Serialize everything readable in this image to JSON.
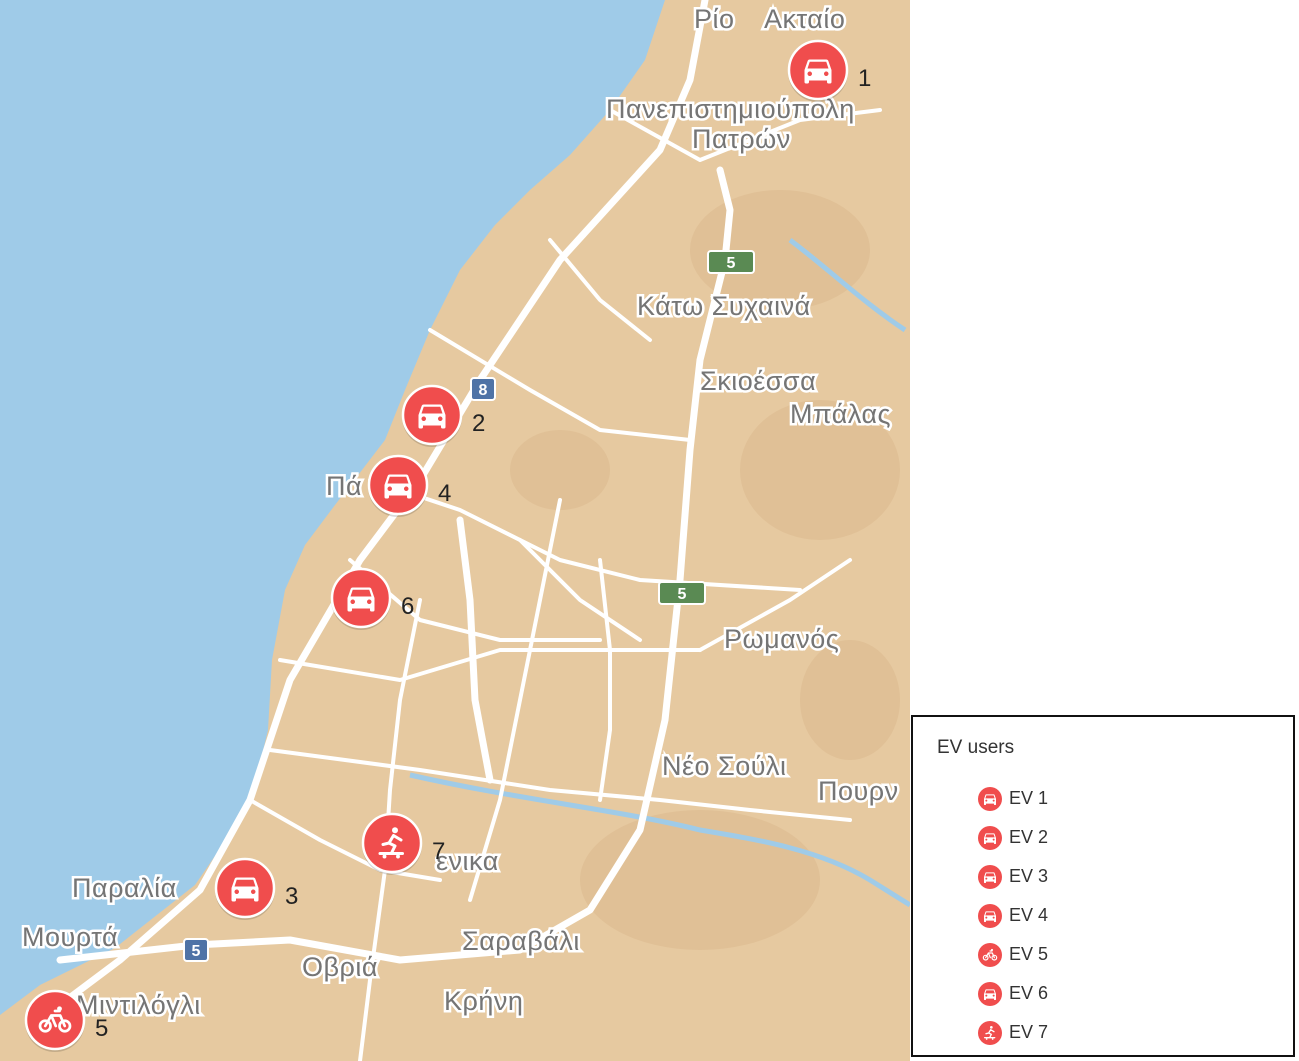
{
  "colors": {
    "water": "#9fcbe8",
    "land": "#e6c9a0",
    "road": "#ffffff",
    "marker": "#f04d4d",
    "shield_green": "#5a8a53",
    "shield_blue": "#4f73a6"
  },
  "places": [
    {
      "text": "Ρίο"
    },
    {
      "text": "Ακταίο"
    },
    {
      "text": "Πανεπιστημιούπολη"
    },
    {
      "text": "Πατρών"
    },
    {
      "text": "Κάτω Συχαινά"
    },
    {
      "text": "Σκιοέσσα"
    },
    {
      "text": "Μπάλας"
    },
    {
      "text": "Πά"
    },
    {
      "text": "Ρωμανός"
    },
    {
      "text": "Νέο Σούλι"
    },
    {
      "text": "Πουρν"
    },
    {
      "text": "ενικα"
    },
    {
      "text": "Παραλία"
    },
    {
      "text": "Μουρτά"
    },
    {
      "text": "Σαραβάλι"
    },
    {
      "text": "Οβριά"
    },
    {
      "text": "Κρήνη"
    },
    {
      "text": "Μιντιλόγλι"
    }
  ],
  "shields": [
    {
      "text": "5",
      "color": "green"
    },
    {
      "text": "8",
      "color": "blue"
    },
    {
      "text": "5",
      "color": "green"
    },
    {
      "text": "5",
      "color": "blue"
    }
  ],
  "markers": [
    {
      "number": "1",
      "icon": "car-icon"
    },
    {
      "number": "2",
      "icon": "car-icon"
    },
    {
      "number": "4",
      "icon": "car-icon"
    },
    {
      "number": "6",
      "icon": "car-icon"
    },
    {
      "number": "7",
      "icon": "skateboard-icon"
    },
    {
      "number": "3",
      "icon": "car-icon"
    },
    {
      "number": "5",
      "icon": "bicycle-icon"
    }
  ],
  "legend": {
    "title": "EV users",
    "items": [
      {
        "label": "EV 1",
        "icon": "car-icon"
      },
      {
        "label": "EV 2",
        "icon": "car-icon"
      },
      {
        "label": "EV 3",
        "icon": "car-icon"
      },
      {
        "label": "EV 4",
        "icon": "car-icon"
      },
      {
        "label": "EV 5",
        "icon": "bicycle-icon"
      },
      {
        "label": "EV 6",
        "icon": "car-icon"
      },
      {
        "label": "EV 7",
        "icon": "skateboard-icon"
      }
    ]
  }
}
